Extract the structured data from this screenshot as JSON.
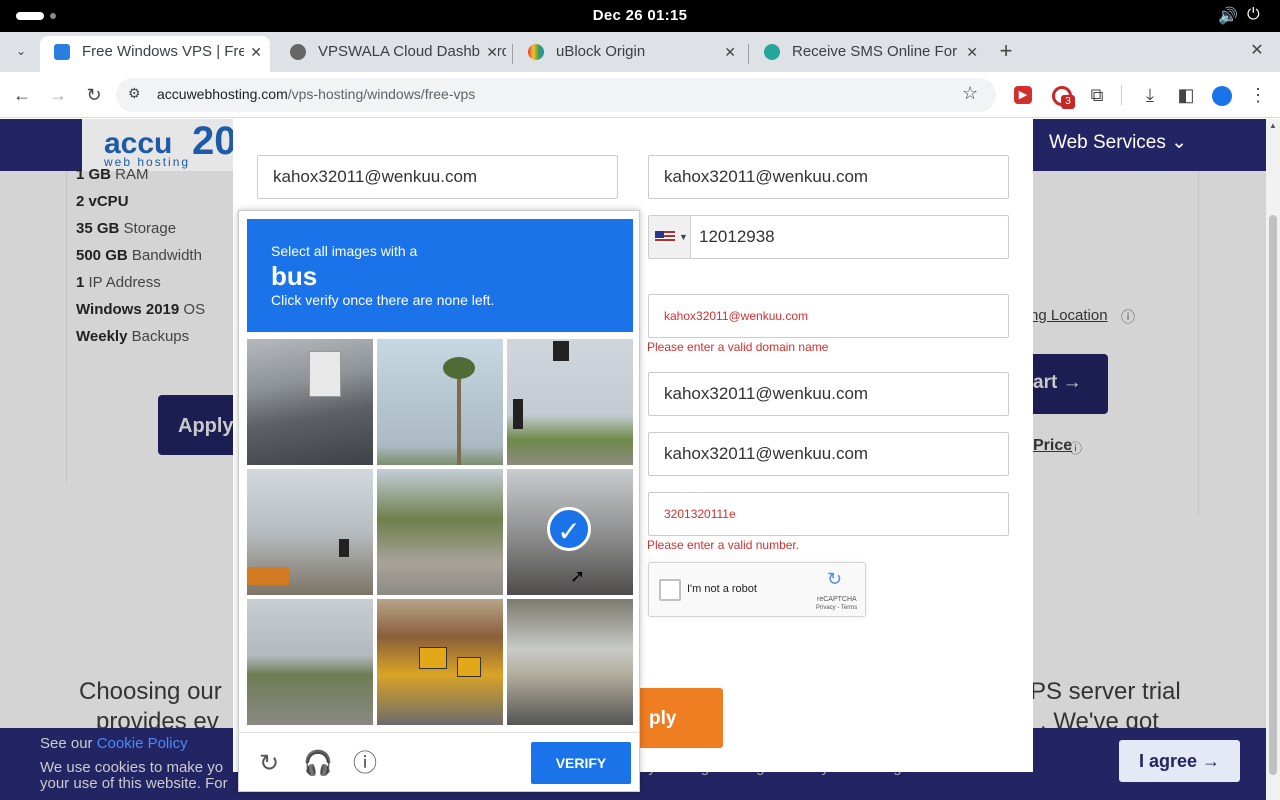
{
  "system": {
    "clock": "Dec 26  01:15"
  },
  "tabs": [
    {
      "title": "Free Windows VPS | Free",
      "active": true
    },
    {
      "title": "VPSWALA Cloud Dashboard"
    },
    {
      "title": "uBlock Origin"
    },
    {
      "title": "Receive SMS Online For"
    }
  ],
  "address": {
    "domain": "accuwebhosting.com",
    "path": "/vps-hosting/windows/free-vps"
  },
  "extensions": {
    "badge_count": "3"
  },
  "site": {
    "logo_text": "accu",
    "logo_sub": "web hosting",
    "logo_num": "20",
    "nav_item": "Web Services",
    "specs": [
      {
        "bold": "1 GB",
        "rest": " RAM"
      },
      {
        "bold": "2 vCPU",
        "rest": ""
      },
      {
        "bold": "35 GB",
        "rest": " Storage"
      },
      {
        "bold": "500 GB",
        "rest": " Bandwidth"
      },
      {
        "bold": "1",
        "rest": " IP Address"
      },
      {
        "bold": "Windows 2019",
        "rest": " OS"
      },
      {
        "bold": "Weekly",
        "rest": " Backups"
      }
    ],
    "apply_label": "Apply",
    "location_link": "ng Location",
    "cart_label": "art",
    "price_link": "Price",
    "headline_l1_left": "Choosing our",
    "headline_l1_right": "PS server trial",
    "headline_l2_left": "provides ev",
    "headline_l2_right": ". We've got"
  },
  "form": {
    "left_email": "kahox32011@wenkuu.com",
    "right_email": "kahox32011@wenkuu.com",
    "phone": "12012938",
    "domain_value": "kahox32011@wenkuu.com",
    "domain_error": "Please enter a valid domain name",
    "email3": "kahox32011@wenkuu.com",
    "email4": "kahox32011@wenkuu.com",
    "number_value": "3201320111e",
    "number_error": "Please enter a valid number.",
    "robot_label": "I'm not a robot",
    "recaptcha_brand": "reCAPTCHA",
    "recaptcha_links": "Privacy - Terms",
    "submit_label": "ply"
  },
  "captcha": {
    "line1": "Select all images with a",
    "line2": "bus",
    "line3": "Click verify once there are none left.",
    "verify_label": "VERIFY",
    "selected_tile": 6
  },
  "cookie": {
    "see_our": "See our",
    "policy_link": "Cookie Policy",
    "text1": "We use cookies to make yo",
    "text2": "your use of this website. For",
    "text_mid": "by clicking on \"I agree\" or by continuing",
    "agree": "I agree"
  }
}
